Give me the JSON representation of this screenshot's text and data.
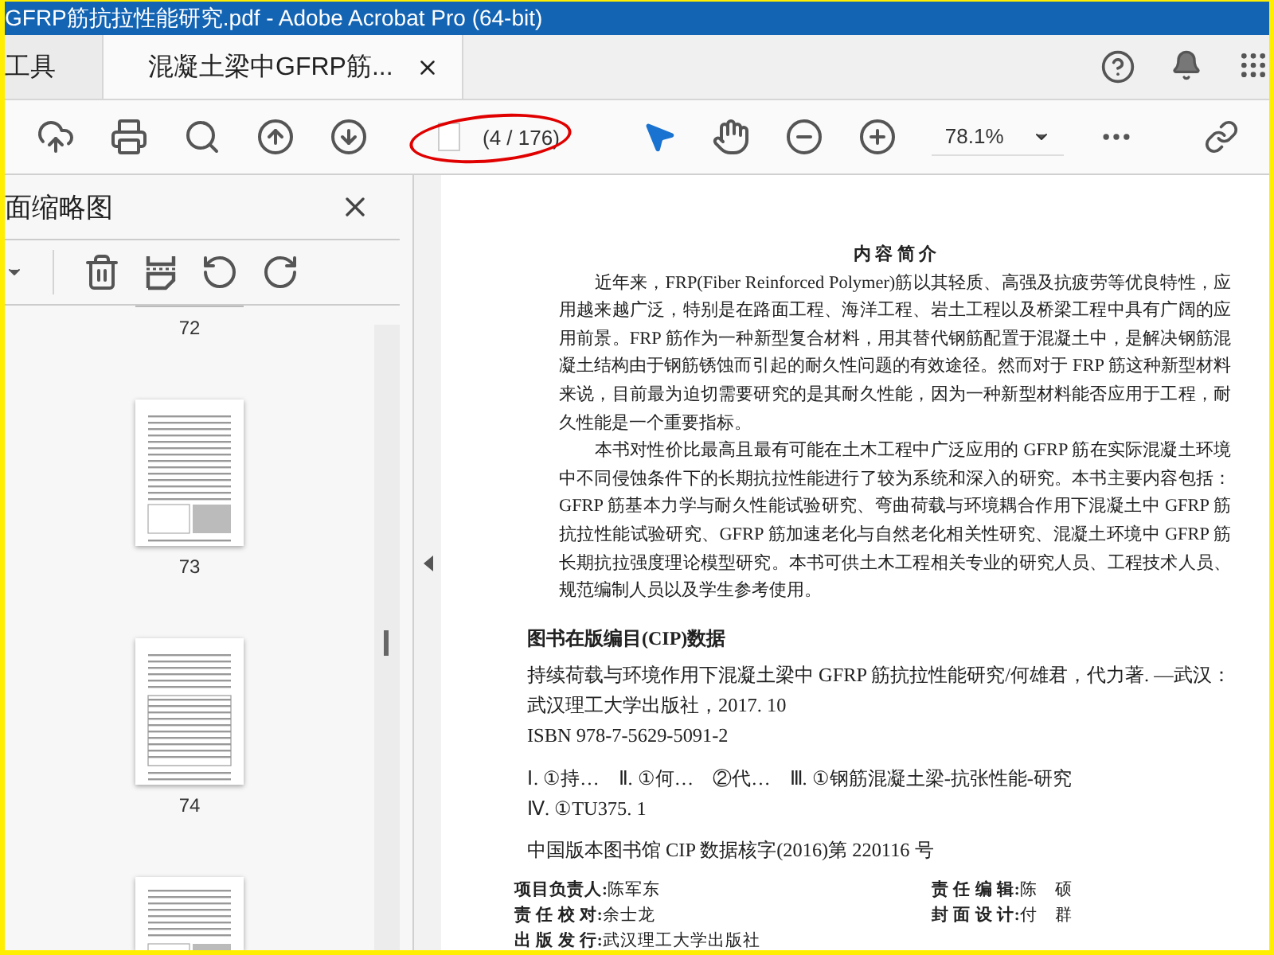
{
  "window": {
    "title": "GFRP筋抗拉性能研究.pdf - Adobe Acrobat Pro (64-bit)"
  },
  "tabs": [
    {
      "label": "工具",
      "selected": false,
      "closable": false
    },
    {
      "label": "混凝土梁中GFRP筋...",
      "selected": true,
      "closable": true
    }
  ],
  "toolbar": {
    "page_indicator": "(4 / 176)",
    "zoom": "78.1%"
  },
  "sidebar": {
    "title": "面缩略图",
    "thumbnails": [
      {
        "kind": "cut-top",
        "label": "72"
      },
      {
        "kind": "figure",
        "label": "73"
      },
      {
        "kind": "table",
        "label": "74"
      },
      {
        "kind": "cut-bottom"
      }
    ]
  },
  "document": {
    "heading": "内 容 简 介",
    "paragraphs": [
      "近年来，FRP(Fiber Reinforced Polymer)筋以其轻质、高强及抗疲劳等优良特性，应用越来越广泛，特别是在路面工程、海洋工程、岩土工程以及桥梁工程中具有广阔的应用前景。FRP 筋作为一种新型复合材料，用其替代钢筋配置于混凝土中，是解决钢筋混凝土结构由于钢筋锈蚀而引起的耐久性问题的有效途径。然而对于 FRP 筋这种新型材料来说，目前最为迫切需要研究的是其耐久性能，因为一种新型材料能否应用于工程，耐久性能是一个重要指标。",
      "本书对性价比最高且最有可能在土木工程中广泛应用的 GFRP 筋在实际混凝土环境中不同侵蚀条件下的长期抗拉性能进行了较为系统和深入的研究。本书主要内容包括：GFRP 筋基本力学与耐久性能试验研究、弯曲荷载与环境耦合作用下混凝土中 GFRP 筋抗拉性能试验研究、GFRP 筋加速老化与自然老化相关性研究、混凝土环境中 GFRP 筋长期抗拉强度理论模型研究。本书可供土木工程相关专业的研究人员、工程技术人员、规范编制人员以及学生参考使用。"
    ],
    "cip_heading": "图书在版编目(CIP)数据",
    "cip_record": [
      "持续荷载与环境作用下混凝土梁中 GFRP 筋抗拉性能研究/何雄君，代力著. —武汉：武汉理工大学出版社，2017. 10",
      "ISBN 978-7-5629-5091-2"
    ],
    "cip_classes": [
      "Ⅰ. ①持…　Ⅱ. ①何…　②代…　Ⅲ. ①钢筋混凝土梁-抗张性能-研究",
      "Ⅳ. ①TU375. 1"
    ],
    "cip_number": "中国版本图书馆 CIP 数据核字(2016)第 220116 号",
    "credits": [
      "**项目负责人:**陈军东",
      "**责 任 编 辑:**陈　硕",
      "**责 任 校 对:**余士龙",
      "**封 面 设 计:**付　群",
      "**出 版 发 行:**武汉理工大学出版社"
    ]
  }
}
